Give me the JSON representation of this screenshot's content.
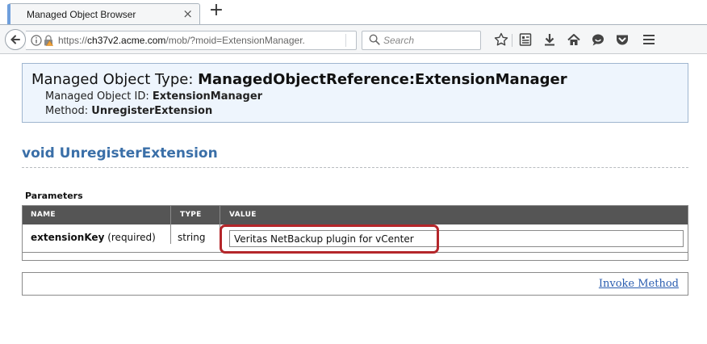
{
  "browser": {
    "tab_title": "Managed Object Browser",
    "close_glyph": "×",
    "new_tab_glyph": "+",
    "url_prefix": "https://",
    "url_host": "ch37v2.acme.com",
    "url_path": "/mob/?moid=ExtensionManager.",
    "search_placeholder": "Search",
    "icons": [
      "back-arrow-icon",
      "info-icon",
      "lock-warning-icon",
      "search-icon",
      "bookmark-star-icon",
      "reading-list-icon",
      "download-icon",
      "home-icon",
      "chat-icon",
      "pocket-icon",
      "menu-icon"
    ]
  },
  "header": {
    "type_label": "Managed Object Type: ",
    "type_value": "ManagedObjectReference:ExtensionManager",
    "id_label": "Managed Object ID: ",
    "id_value": "ExtensionManager",
    "method_label": "Method: ",
    "method_value": "UnregisterExtension"
  },
  "method": {
    "heading": "void UnregisterExtension"
  },
  "parameters": {
    "label": "Parameters",
    "columns": [
      "NAME",
      "TYPE",
      "VALUE"
    ],
    "rows": [
      {
        "name": "extensionKey",
        "qualifier": " (required)",
        "type": "string",
        "value": "Veritas NetBackup plugin for vCenter"
      }
    ]
  },
  "actions": {
    "invoke_label": "Invoke Method"
  },
  "colors": {
    "header_bg": "#eef5fd",
    "heading_blue": "#3a6fa8",
    "table_header": "#555555",
    "highlight_ring": "#b4262a",
    "link": "#2a5db0"
  }
}
